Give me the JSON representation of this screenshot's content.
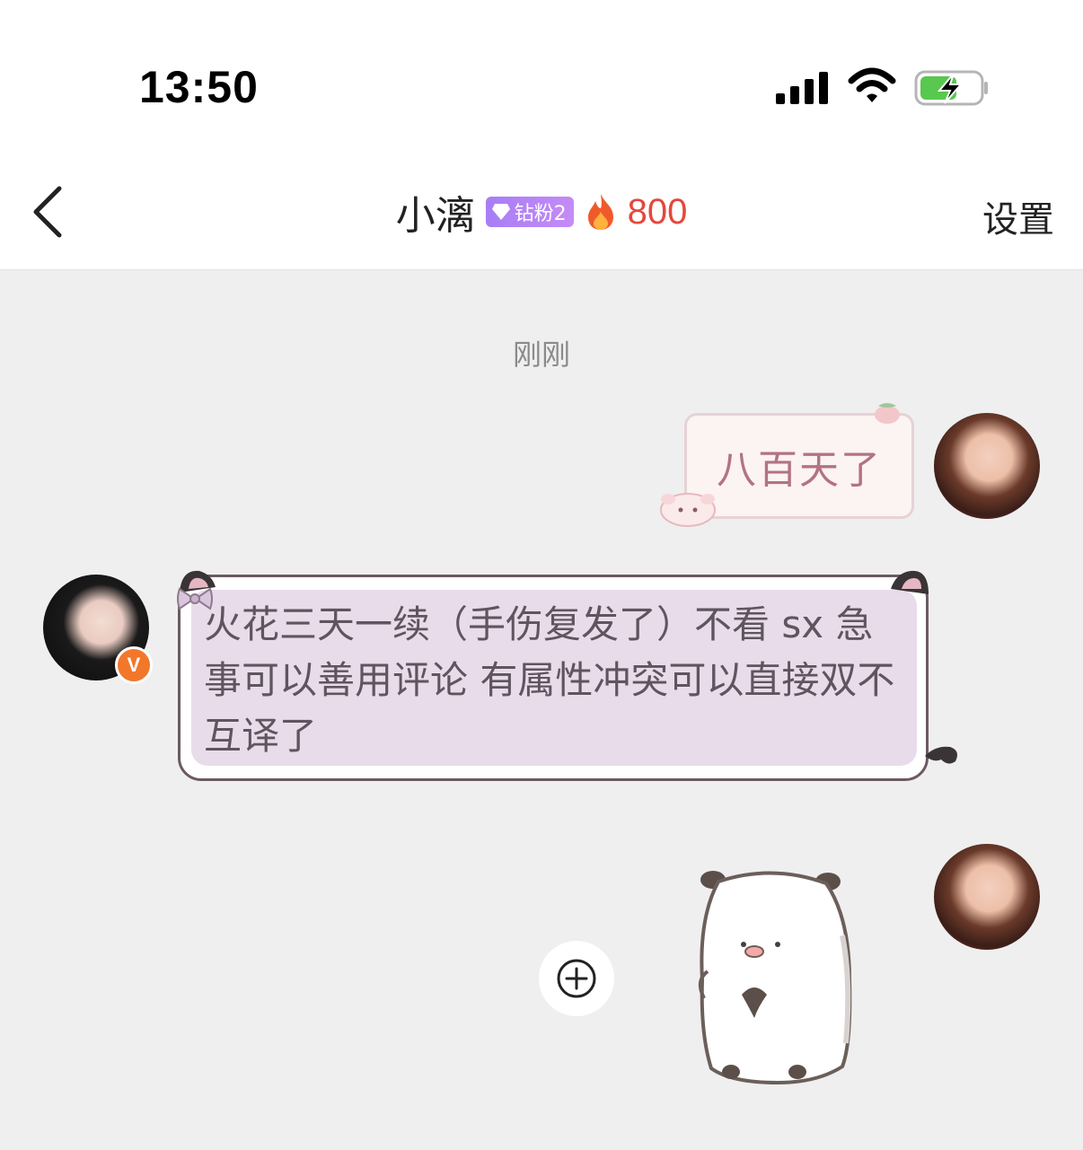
{
  "status_bar": {
    "time": "13:50"
  },
  "nav": {
    "back_icon": "chevron-left-icon",
    "contact_name": "小漓",
    "fan_badge": {
      "label": "钻粉2",
      "icon": "diamond-icon",
      "color": "#a77ef5"
    },
    "streak": {
      "icon": "flame-icon",
      "count": "800",
      "color": "#e4483b"
    },
    "settings_label": "设置"
  },
  "chat": {
    "timestamp": "刚刚",
    "messages": [
      {
        "sender": "me",
        "text": "八百天了"
      },
      {
        "sender": "other",
        "verified_badge": "V",
        "text": "火花三天一续（手伤复发了）不看 sx 急事可以善用评论 有属性冲突可以直接双不互译了"
      },
      {
        "sender": "me",
        "sticker": "white-bear-sticker"
      }
    ],
    "add_icon": "plus-circle-icon"
  }
}
